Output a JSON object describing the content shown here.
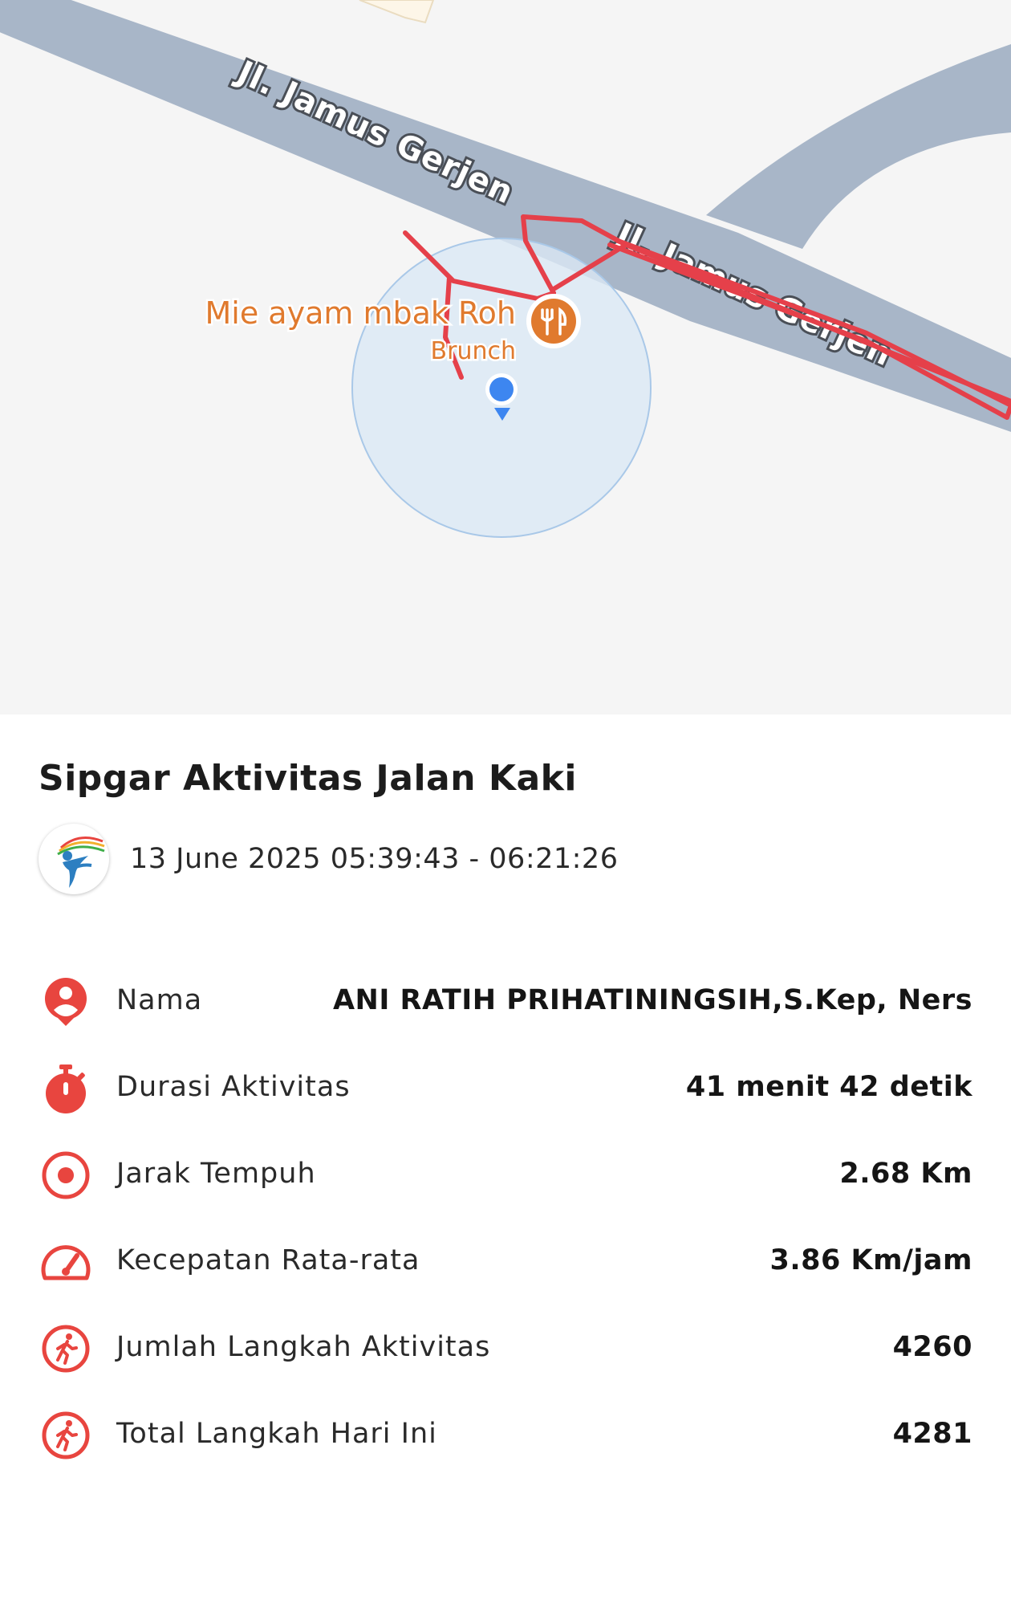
{
  "map": {
    "road_label_top": "Jl. Jamus Gerjen",
    "road_label_right": "Jl. Jamus Gerjen",
    "poi_name": "Mie ayam mbak Roh",
    "poi_category": "Brunch",
    "poi_icon": "fork-knife-icon",
    "colors": {
      "background": "#f5f5f5",
      "road": "#a8b6c8",
      "route": "#e5404a",
      "poi": "#e07a2e",
      "accuracy_circle": "#dbe8f5",
      "location_dot": "#3d86f0"
    }
  },
  "activity": {
    "title": "Sipgar Aktivitas Jalan Kaki",
    "datetime": "13 June 2025 05:39:43 - 06:21:26",
    "accent_color": "#e8453f",
    "rows": [
      {
        "icon": "person-pin-icon",
        "label": "Nama",
        "value": "ANI RATIH PRIHATININGSIH,S.Kep, Ners"
      },
      {
        "icon": "stopwatch-icon",
        "label": "Durasi Aktivitas",
        "value": "41 menit 42 detik"
      },
      {
        "icon": "target-icon",
        "label": "Jarak Tempuh",
        "value": "2.68 Km"
      },
      {
        "icon": "speedometer-icon",
        "label": "Kecepatan Rata-rata",
        "value": "3.86 Km/jam"
      },
      {
        "icon": "walking-icon",
        "label": "Jumlah Langkah Aktivitas",
        "value": "4260"
      },
      {
        "icon": "walking-icon",
        "label": "Total Langkah Hari Ini",
        "value": "4281"
      }
    ]
  }
}
